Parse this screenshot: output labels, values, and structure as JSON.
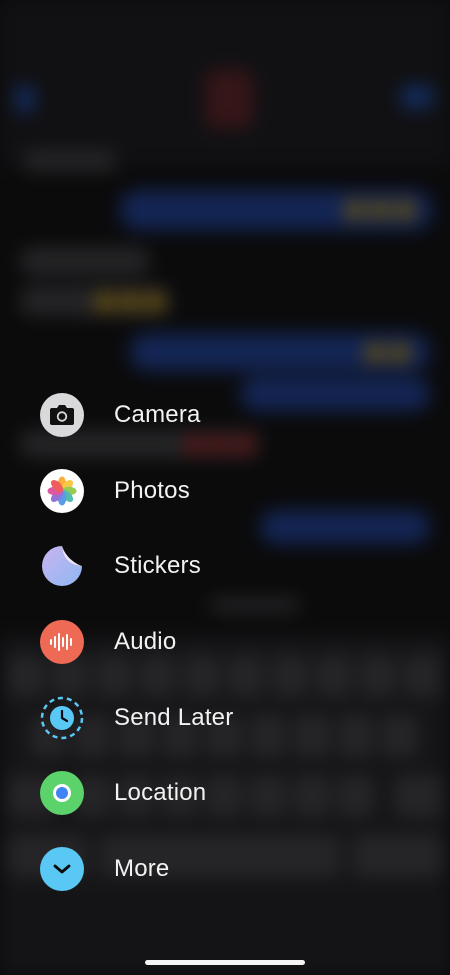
{
  "menu": {
    "items": [
      {
        "label": "Camera",
        "icon": "camera-icon"
      },
      {
        "label": "Photos",
        "icon": "photos-icon"
      },
      {
        "label": "Stickers",
        "icon": "stickers-icon"
      },
      {
        "label": "Audio",
        "icon": "audio-waveform-icon"
      },
      {
        "label": "Send Later",
        "icon": "clock-icon"
      },
      {
        "label": "Location",
        "icon": "location-icon"
      },
      {
        "label": "More",
        "icon": "chevron-down-icon"
      }
    ]
  },
  "colors": {
    "camera": "#d9d9dc",
    "audio": "#ef6a55",
    "send_later": "#5ac8f5",
    "location": "#5cd26a",
    "more": "#5ac8f5",
    "label": "#f2f2f2",
    "background": "#0b0b0c"
  }
}
